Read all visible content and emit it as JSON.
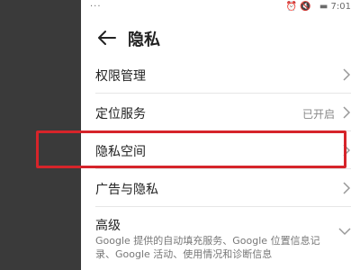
{
  "status_bar": {
    "carrier": "···",
    "icons": "⏰ 🔇",
    "battery": "▬",
    "time": "7:01"
  },
  "header": {
    "title": "隐私"
  },
  "list": [
    {
      "label": "权限管理",
      "value": ""
    },
    {
      "label": "定位服务",
      "value": "已开启"
    },
    {
      "label": "隐私空间",
      "value": ""
    },
    {
      "label": "广告与隐私",
      "value": ""
    }
  ],
  "advanced": {
    "title": "高级",
    "desc": "Google 提供的自动填充服务、Google 位置信息记录、Google 活动、使用情况和诊断信息"
  },
  "colors": {
    "highlight": "#d6242a"
  }
}
